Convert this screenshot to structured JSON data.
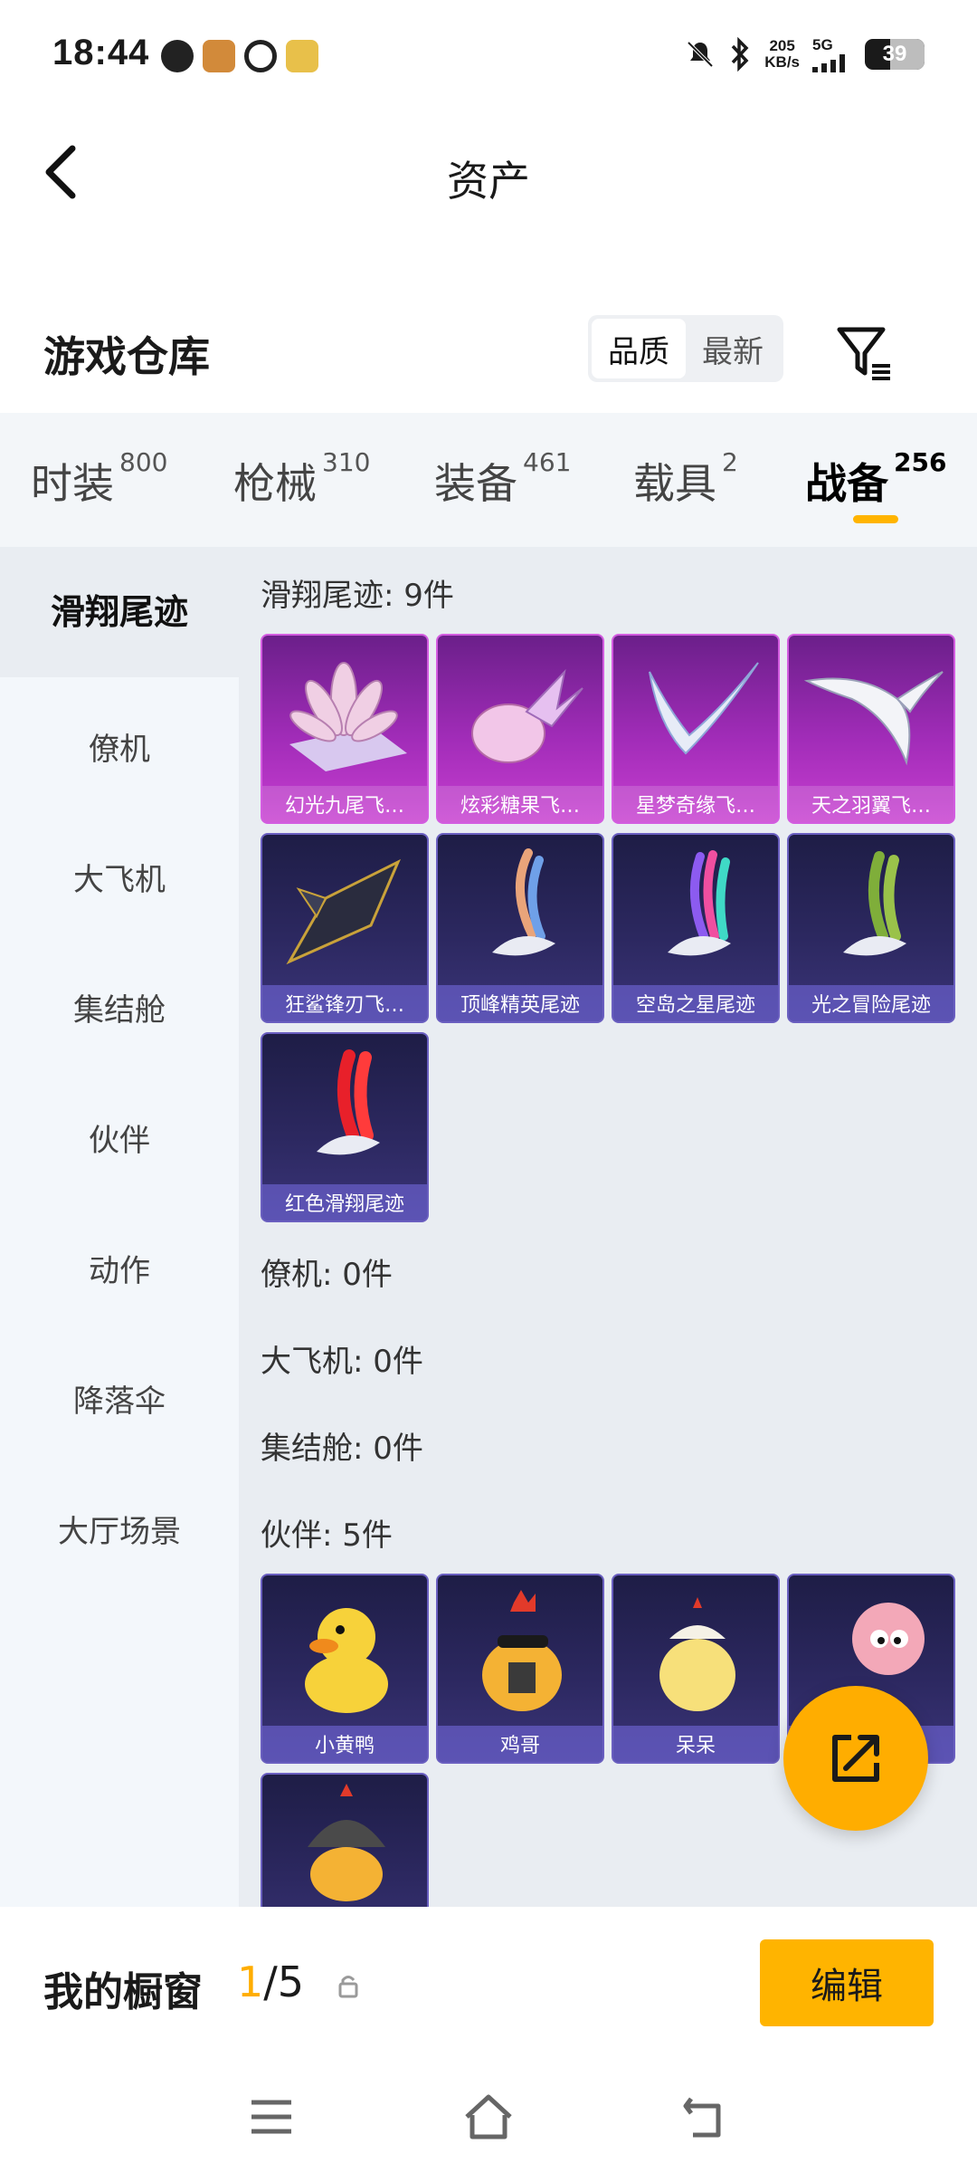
{
  "status_bar": {
    "time": "18:44",
    "net_speed_value": "205",
    "net_speed_unit": "KB/s",
    "signal": "5G",
    "battery": "39"
  },
  "header": {
    "title": "资产",
    "back_icon": "chevron-left-icon"
  },
  "warehouse": {
    "title": "游戏仓库",
    "sort_options": [
      "品质",
      "最新"
    ],
    "sort_selected": "品质",
    "filter_icon": "filter-icon"
  },
  "category_tabs": [
    {
      "label": "时装",
      "count": "800"
    },
    {
      "label": "枪械",
      "count": "310"
    },
    {
      "label": "装备",
      "count": "461"
    },
    {
      "label": "载具",
      "count": "2"
    },
    {
      "label": "战备",
      "count": "256"
    }
  ],
  "active_tab": "战备",
  "sidebar": [
    {
      "label": "滑翔尾迹"
    },
    {
      "label": "僚机"
    },
    {
      "label": "大飞机"
    },
    {
      "label": "集结舱"
    },
    {
      "label": "伙伴"
    },
    {
      "label": "动作"
    },
    {
      "label": "降落伞"
    },
    {
      "label": "大厅场景"
    }
  ],
  "sections": {
    "glide_trail": {
      "label": "滑翔尾迹: 9件",
      "items": [
        {
          "name": "幻光九尾飞…",
          "rarity": "purple"
        },
        {
          "name": "炫彩糖果飞…",
          "rarity": "purple"
        },
        {
          "name": "星梦奇缘飞…",
          "rarity": "purple"
        },
        {
          "name": "天之羽翼飞…",
          "rarity": "purple"
        },
        {
          "name": "狂鲨锋刃飞…",
          "rarity": "navy"
        },
        {
          "name": "顶峰精英尾迹",
          "rarity": "navy"
        },
        {
          "name": "空岛之星尾迹",
          "rarity": "navy"
        },
        {
          "name": "光之冒险尾迹",
          "rarity": "navy"
        },
        {
          "name": "红色滑翔尾迹",
          "rarity": "navy"
        }
      ]
    },
    "wingman": {
      "label": "僚机: 0件"
    },
    "big_plane": {
      "label": "大飞机: 0件"
    },
    "assembly_pod": {
      "label": "集结舱: 0件"
    },
    "partner": {
      "label": "伙伴: 5件",
      "items": [
        {
          "name": "小黄鸭"
        },
        {
          "name": "鸡哥"
        },
        {
          "name": "呆呆"
        },
        {
          "name": ""
        },
        {
          "name": ""
        }
      ]
    }
  },
  "fab": {
    "icon": "share-icon"
  },
  "showcase": {
    "label": "我的橱窗",
    "current": "1",
    "total": "/5",
    "edit_label": "编辑"
  },
  "nav_bar": {
    "icons": [
      "menu-icon",
      "home-icon",
      "back-icon"
    ]
  },
  "colors": {
    "accent": "#ffb400",
    "purple_card": "#a12cb8",
    "navy_card": "#2c2860"
  }
}
